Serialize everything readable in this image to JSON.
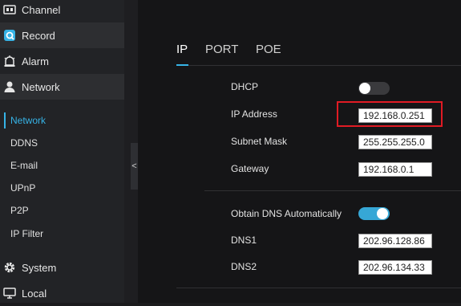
{
  "sidebar": {
    "menu": [
      {
        "label": "Channel",
        "icon": "channel-icon"
      },
      {
        "label": "Record",
        "icon": "record-icon"
      },
      {
        "label": "Alarm",
        "icon": "alarm-icon"
      },
      {
        "label": "Network",
        "icon": "network-icon"
      }
    ],
    "submenu": [
      {
        "label": "Network",
        "active": true
      },
      {
        "label": "DDNS",
        "active": false
      },
      {
        "label": "E-mail",
        "active": false
      },
      {
        "label": "UPnP",
        "active": false
      },
      {
        "label": "P2P",
        "active": false
      },
      {
        "label": "IP Filter",
        "active": false
      }
    ],
    "menu_bottom": [
      {
        "label": "System",
        "icon": "gear-icon"
      },
      {
        "label": "Local",
        "icon": "monitor-icon"
      }
    ],
    "collapse_glyph": "<"
  },
  "tabs": [
    {
      "label": "IP",
      "active": true
    },
    {
      "label": "PORT",
      "active": false
    },
    {
      "label": "POE",
      "active": false
    }
  ],
  "form": {
    "dhcp": {
      "label": "DHCP",
      "enabled": false
    },
    "ip_address": {
      "label": "IP Address",
      "value": "192.168.0.251"
    },
    "subnet_mask": {
      "label": "Subnet Mask",
      "value": "255.255.255.0"
    },
    "gateway": {
      "label": "Gateway",
      "value": "192.168.0.1"
    },
    "obtain_dns": {
      "label": "Obtain DNS Automatically",
      "enabled": true
    },
    "dns1": {
      "label": "DNS1",
      "value": "202.96.128.86"
    },
    "dns2": {
      "label": "DNS2",
      "value": "202.96.134.33"
    }
  },
  "colors": {
    "accent": "#36b3e6",
    "highlight": "#e01b24",
    "toggle_on": "#36a7d6"
  }
}
